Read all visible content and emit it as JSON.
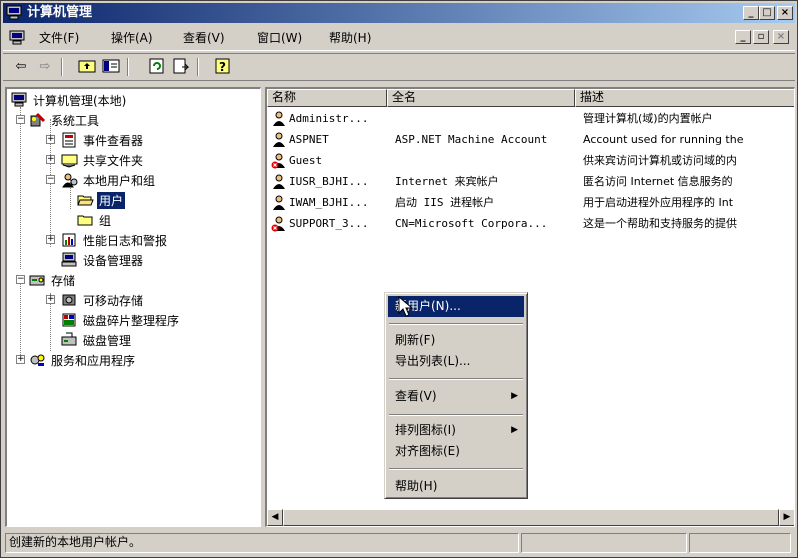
{
  "window": {
    "title": "计算机管理"
  },
  "menubar": {
    "items": [
      "文件(F)",
      "操作(A)",
      "查看(V)",
      "窗口(W)",
      "帮助(H)"
    ]
  },
  "toolbar": {
    "icons": [
      "back-arrow-icon",
      "forward-arrow-icon",
      "up-folder-icon",
      "show-hide-tree-icon",
      "refresh-icon",
      "export-list-icon",
      "help-icon"
    ]
  },
  "tree": {
    "root": "计算机管理(本地)",
    "system_tools": "系统工具",
    "event_viewer": "事件查看器",
    "shared_folders": "共享文件夹",
    "local_users_groups": "本地用户和组",
    "users": "用户",
    "groups": "组",
    "perf_logs": "性能日志和警报",
    "device_manager": "设备管理器",
    "storage": "存储",
    "removable_storage": "可移动存储",
    "defrag": "磁盘碎片整理程序",
    "disk_management": "磁盘管理",
    "services_apps": "服务和应用程序"
  },
  "list": {
    "columns": [
      "名称",
      "全名",
      "描述"
    ],
    "rows": [
      {
        "name": "Administr...",
        "full_name": "",
        "description": "管理计算机(域)的内置帐户",
        "disabled": false
      },
      {
        "name": "ASPNET",
        "full_name": "ASP.NET Machine Account",
        "description": "Account used for running the",
        "disabled": false
      },
      {
        "name": "Guest",
        "full_name": "",
        "description": "供来宾访问计算机或访问域的内",
        "disabled": true
      },
      {
        "name": "IUSR_BJHI...",
        "full_name": "Internet 来宾帐户",
        "description": "匿名访问 Internet 信息服务的",
        "disabled": false
      },
      {
        "name": "IWAM_BJHI...",
        "full_name": "启动 IIS 进程帐户",
        "description": "用于启动进程外应用程序的 Int",
        "disabled": false
      },
      {
        "name": "SUPPORT_3...",
        "full_name": "CN=Microsoft Corpora...",
        "description": "这是一个帮助和支持服务的提供",
        "disabled": true
      }
    ]
  },
  "context_menu": {
    "new_user": "新用户(N)...",
    "refresh": "刷新(F)",
    "export_list": "导出列表(L)...",
    "view": "查看(V)",
    "arrange_icons": "排列图标(I)",
    "line_up_icons": "对齐图标(E)",
    "help": "帮助(H)"
  },
  "statusbar": {
    "text": "创建新的本地用户帐户。"
  },
  "colors": {
    "titlebar_start": "#0a246a",
    "titlebar_end": "#a6caf0",
    "selection": "#0a246a",
    "face": "#d4d0c8"
  }
}
